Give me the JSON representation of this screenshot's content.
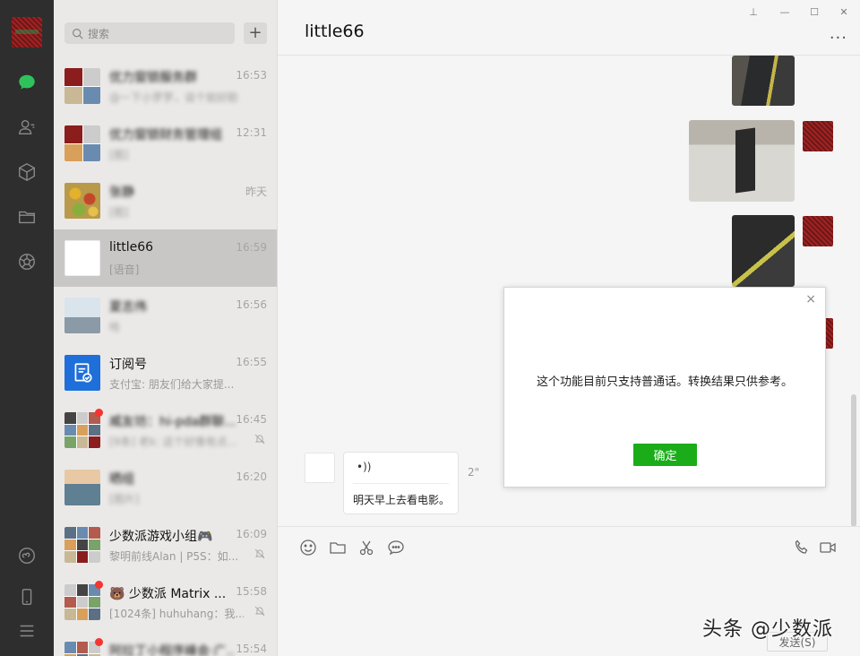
{
  "search": {
    "placeholder": "搜索"
  },
  "add_label": "+",
  "conversations": [
    {
      "name": "优力窗锁服务群",
      "time": "16:53",
      "preview": "@一下小罗罗，说个就好脸"
    },
    {
      "name": "优力窗锁财务管理组",
      "time": "12:31",
      "preview": "[图]"
    },
    {
      "name": "张静",
      "time": "昨天",
      "preview": "[图]"
    },
    {
      "name": "little66",
      "time": "16:59",
      "preview": "[语音]"
    },
    {
      "name": "夏志伟",
      "time": "16:56",
      "preview": "哈"
    },
    {
      "name": "订阅号",
      "time": "16:55",
      "preview": "支付宝: 朋友们给大家提..."
    },
    {
      "name": "威友坊：hi-pda群聊...",
      "time": "16:45",
      "preview": "[9条] 老k: 这个好像有点..."
    },
    {
      "name": "晒组",
      "time": "16:20",
      "preview": "[图片]"
    },
    {
      "name": "少数派游戏小组🎮",
      "time": "16:09",
      "preview": "黎明前线Alan | P5S：如..."
    },
    {
      "name": "🐻 少数派 Matrix ...",
      "time": "15:58",
      "preview": "[1024条] huhuhang：我..."
    },
    {
      "name": "阿拉丁小程序峰会·广...",
      "time": "15:54",
      "preview": ""
    }
  ],
  "chat": {
    "title": "little66",
    "more": "···",
    "voice_wave": "•))",
    "voice_text": "明天早上去看电影。",
    "voice_duration": "2\""
  },
  "dialog": {
    "close": "×",
    "message": "这个功能目前只支持普通话。转换结果只供参考。",
    "ok_label": "确定"
  },
  "window_controls": {
    "pin": "⊥",
    "minimize": "—",
    "maximize": "☐",
    "close": "✕"
  },
  "send_label": "发送(S)",
  "watermark": "头条 @少数派",
  "colors": {
    "accent_green": "#1aad19",
    "unread_red": "#f43530",
    "nav_dark": "#2e2e2e"
  }
}
